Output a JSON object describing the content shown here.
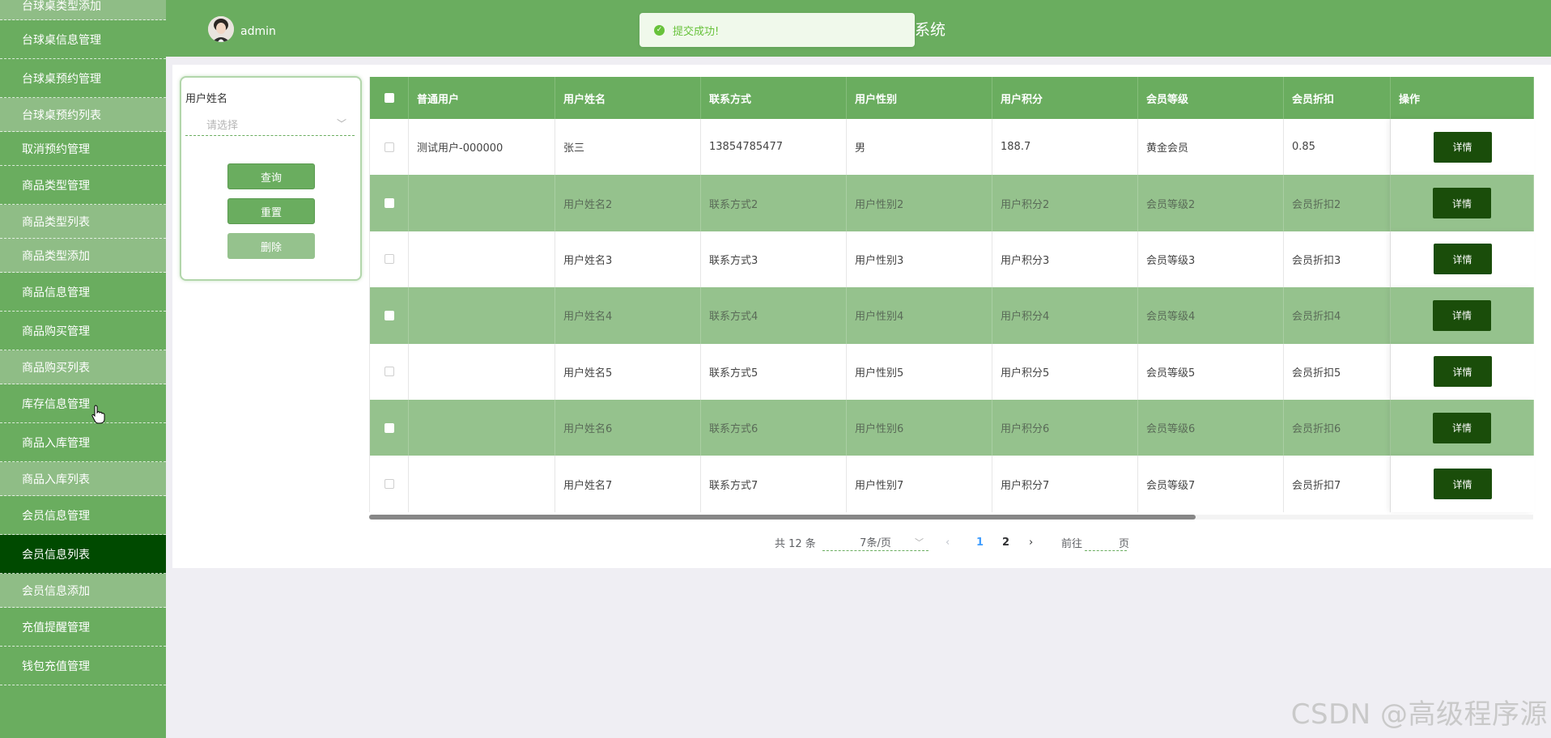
{
  "sidebar": {
    "items": [
      {
        "label": "台球桌类型添加",
        "kind": "child"
      },
      {
        "label": "台球桌信息管理",
        "kind": "parent"
      },
      {
        "label": "台球桌预约管理",
        "kind": "parent"
      },
      {
        "label": "台球桌预约列表",
        "kind": "child"
      },
      {
        "label": "取消预约管理",
        "kind": "parent"
      },
      {
        "label": "商品类型管理",
        "kind": "parent"
      },
      {
        "label": "商品类型列表",
        "kind": "child"
      },
      {
        "label": "商品类型添加",
        "kind": "child"
      },
      {
        "label": "商品信息管理",
        "kind": "parent"
      },
      {
        "label": "商品购买管理",
        "kind": "parent"
      },
      {
        "label": "商品购买列表",
        "kind": "child"
      },
      {
        "label": "库存信息管理",
        "kind": "parent"
      },
      {
        "label": "商品入库管理",
        "kind": "parent"
      },
      {
        "label": "商品入库列表",
        "kind": "child"
      },
      {
        "label": "会员信息管理",
        "kind": "parent"
      },
      {
        "label": "会员信息列表",
        "kind": "active"
      },
      {
        "label": "会员信息添加",
        "kind": "child"
      },
      {
        "label": "充值提醒管理",
        "kind": "parent"
      },
      {
        "label": "钱包充值管理",
        "kind": "parent"
      }
    ]
  },
  "header": {
    "username": "admin",
    "title_visible": "系统",
    "toast": "提交成功!"
  },
  "search": {
    "label": "用户姓名",
    "placeholder": "请选择",
    "query_label": "查询",
    "reset_label": "重置",
    "delete_label": "删除"
  },
  "table": {
    "headers": [
      "普通用户",
      "用户姓名",
      "联系方式",
      "用户性别",
      "用户积分",
      "会员等级",
      "会员折扣",
      "操作"
    ],
    "rows": [
      [
        "测试用户-000000",
        "张三",
        "13854785477",
        "男",
        "188.7",
        "黄金会员",
        "0.85"
      ],
      [
        "",
        "用户姓名2",
        "联系方式2",
        "用户性别2",
        "用户积分2",
        "会员等级2",
        "会员折扣2"
      ],
      [
        "",
        "用户姓名3",
        "联系方式3",
        "用户性别3",
        "用户积分3",
        "会员等级3",
        "会员折扣3"
      ],
      [
        "",
        "用户姓名4",
        "联系方式4",
        "用户性别4",
        "用户积分4",
        "会员等级4",
        "会员折扣4"
      ],
      [
        "",
        "用户姓名5",
        "联系方式5",
        "用户性别5",
        "用户积分5",
        "会员等级5",
        "会员折扣5"
      ],
      [
        "",
        "用户姓名6",
        "联系方式6",
        "用户性别6",
        "用户积分6",
        "会员等级6",
        "会员折扣6"
      ],
      [
        "",
        "用户姓名7",
        "联系方式7",
        "用户性别7",
        "用户积分7",
        "会员等级7",
        "会员折扣7"
      ]
    ],
    "action_label": "详情"
  },
  "pagination": {
    "total": "共 12 条",
    "page_size": "7条/页",
    "pages": [
      "1",
      "2"
    ],
    "current_page": "1",
    "goto_label": "前往",
    "page_unit": "页"
  },
  "watermark": "CSDN @高级程序源",
  "colors": {
    "primary_green": "#6aad5f",
    "light_green": "#95c28d",
    "active_dark": "#004a00",
    "detail_button": "#1a4d0a"
  }
}
